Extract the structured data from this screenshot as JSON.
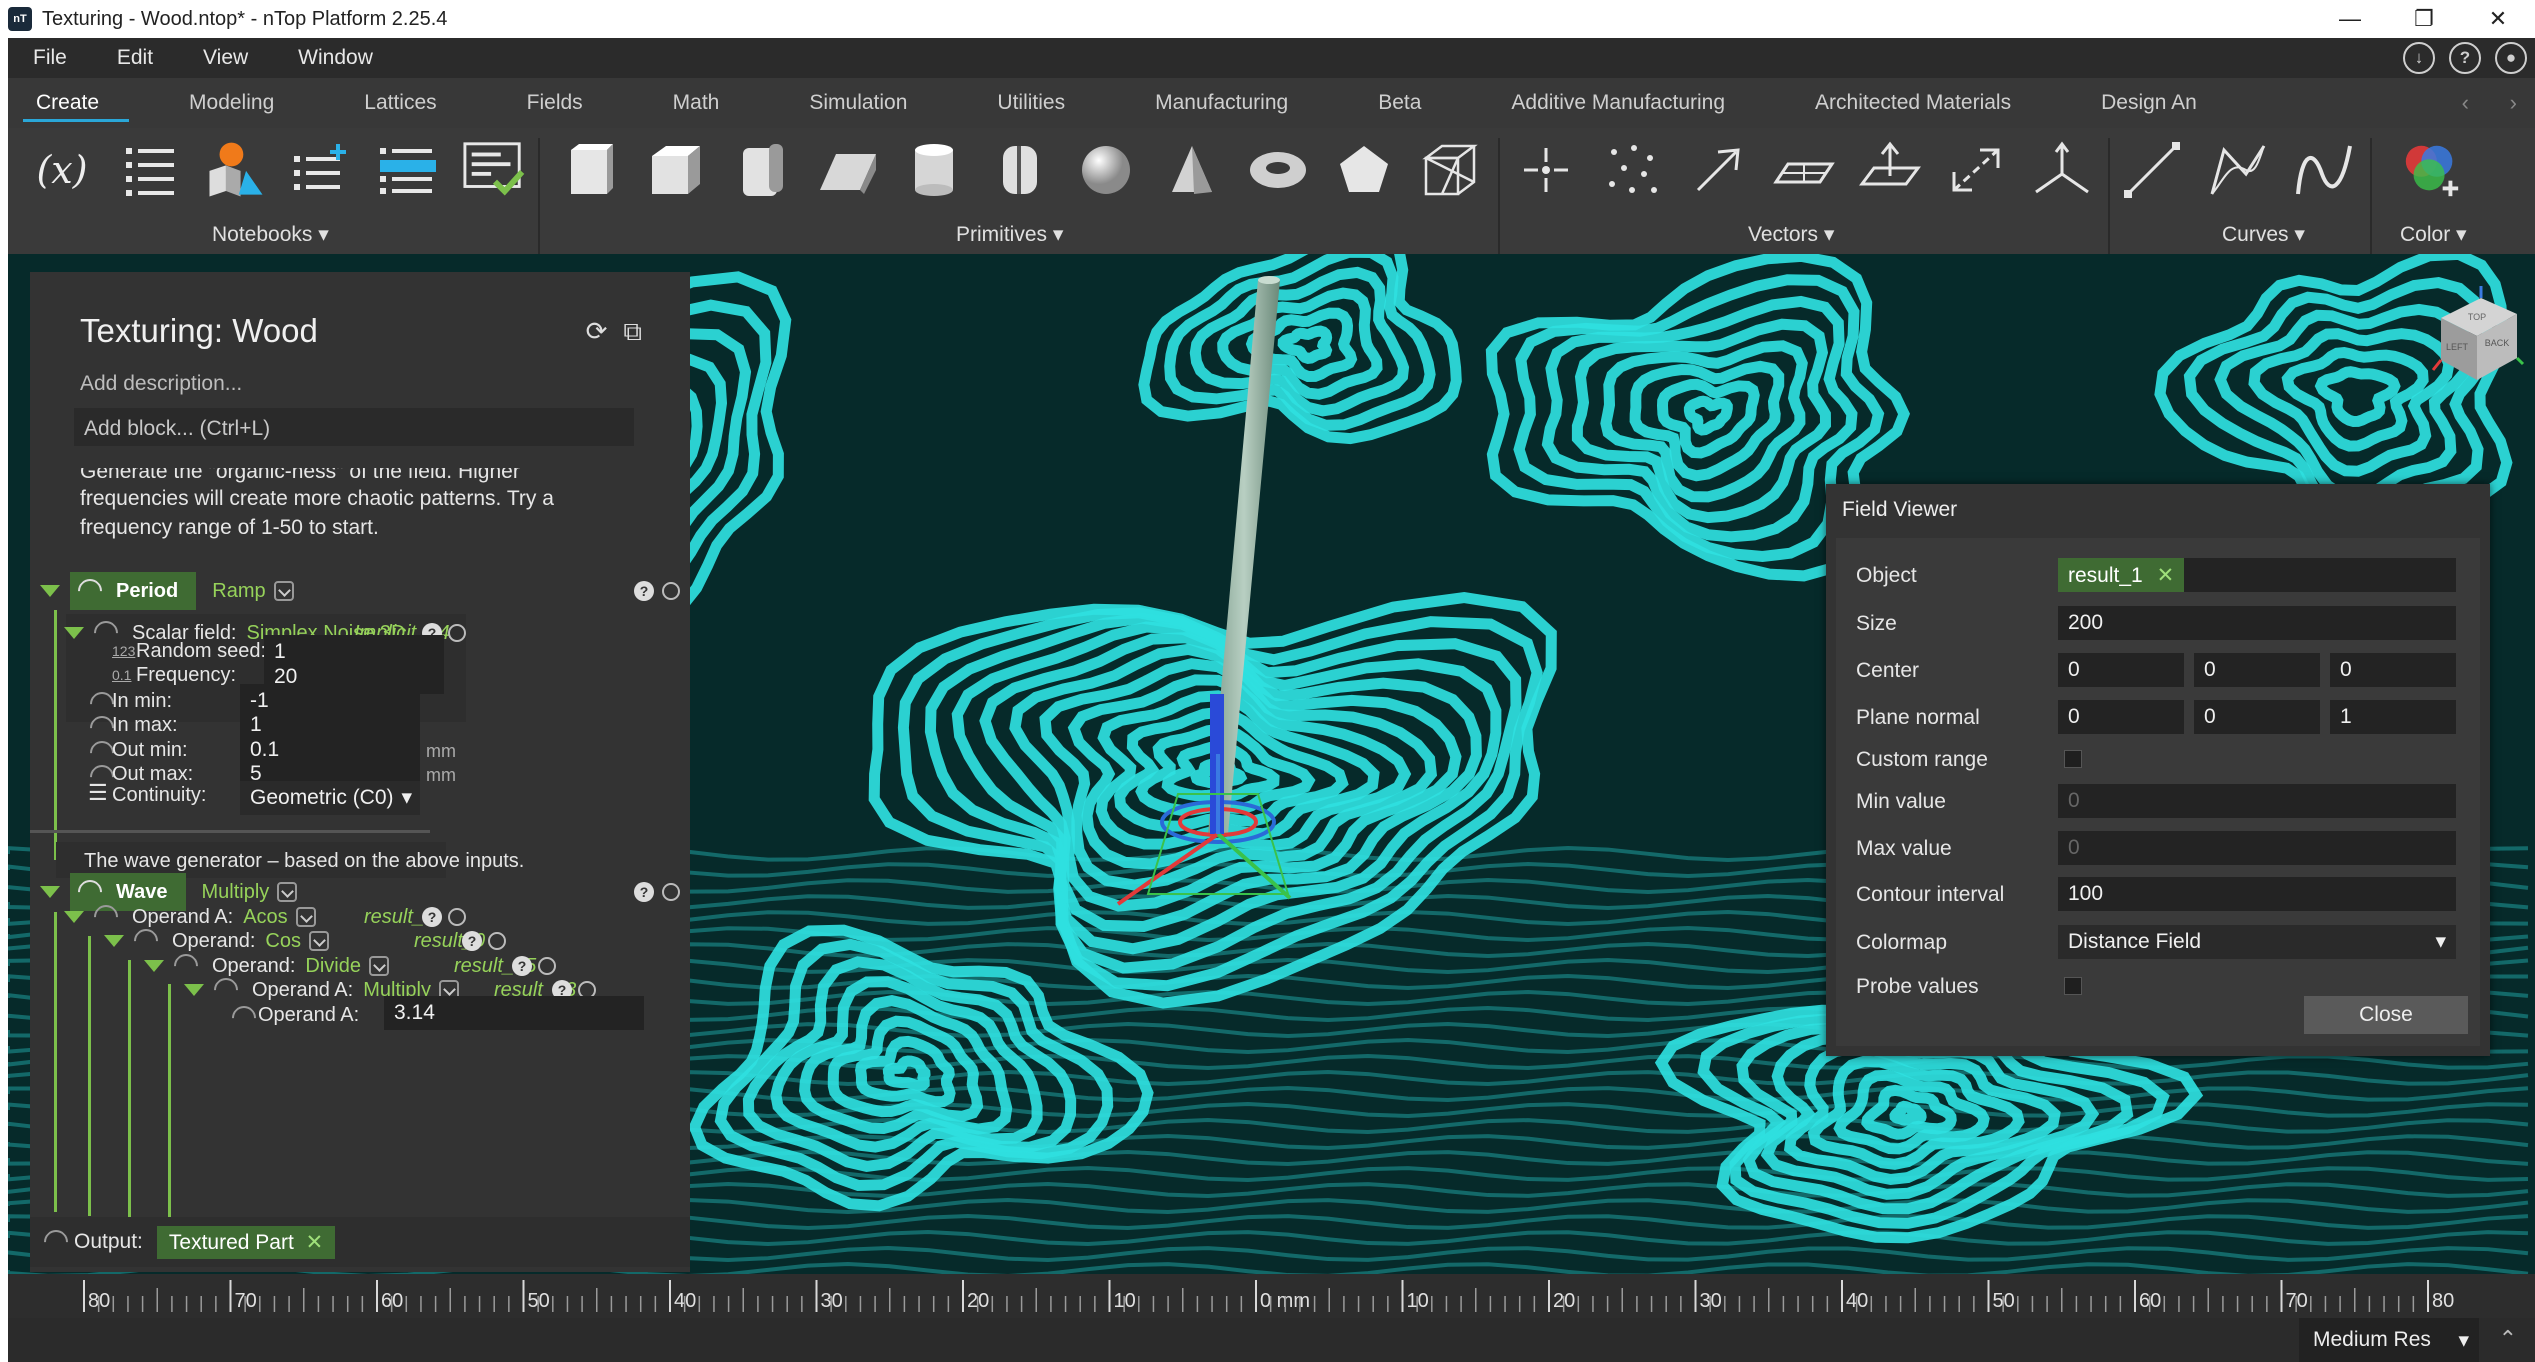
{
  "window": {
    "title": "Texturing - Wood.ntop* - nTop Platform 2.25.4",
    "controls": [
      "—",
      "❐",
      "✕"
    ]
  },
  "menu": [
    "File",
    "Edit",
    "View",
    "Window"
  ],
  "top_icons": [
    "download-icon",
    "help-icon",
    "user-icon"
  ],
  "tabs": [
    "Create",
    "Modeling",
    "Lattices",
    "Fields",
    "Math",
    "Simulation",
    "Utilities",
    "Manufacturing",
    "Beta",
    "Additive Manufacturing",
    "Architected Materials",
    "Design An"
  ],
  "active_tab": "Create",
  "ribbon_groups": {
    "notebooks": "Notebooks",
    "primitives": "Primitives",
    "vectors": "Vectors",
    "curves": "Curves",
    "color": "Color"
  },
  "ribbon_icons": {
    "variable_glyph": "(x)",
    "notebooks": [
      "variable-icon",
      "list-icon",
      "shapes-icon",
      "add-list-icon",
      "edit-list-icon",
      "notebook-check-icon"
    ],
    "primitives": [
      "box-icon",
      "cube-icon",
      "rounded-box-icon",
      "wedge-icon",
      "cylinder-icon",
      "capsule-icon",
      "sphere-icon",
      "cone-icon",
      "torus-icon",
      "pentagon-icon",
      "wireframe-cube-icon"
    ],
    "vectors": [
      "point-icon",
      "point-cloud-icon",
      "vector-icon",
      "plane-icon",
      "plane-normal-icon",
      "line-segment-icon",
      "coordinate-system-icon"
    ],
    "curves": [
      "line-icon",
      "polyline-icon",
      "spline-icon"
    ],
    "color": [
      "color-icon"
    ]
  },
  "notebook": {
    "title": "Texturing: Wood",
    "description_placeholder": "Add description...",
    "add_block_placeholder": "Add block... (Ctrl+L)",
    "note_lines": [
      "Generate the \"organic-ness\" of the field. Higher",
      "frequencies will create more chaotic patterns. Try a",
      "frequency range of 1-50 to start."
    ],
    "period": {
      "name": "Period",
      "type": "Ramp",
      "scalar_field_label": "Scalar field:",
      "scalar_field_value": "Simplex Noise 3D",
      "scalar_field_ref": "Implicit_14",
      "random_seed_label": "Random seed:",
      "random_seed_value": "1",
      "random_seed_badge": "123",
      "frequency_label": "Frequency:",
      "frequency_value": "20",
      "frequency_badge": "0.1",
      "in_min_label": "In min:",
      "in_min_value": "-1",
      "in_max_label": "In max:",
      "in_max_value": "1",
      "out_min_label": "Out min:",
      "out_min_value": "0.1",
      "out_min_unit": "mm",
      "out_max_label": "Out max:",
      "out_max_value": "5",
      "out_max_unit": "mm",
      "continuity_label": "Continuity:",
      "continuity_value": "Geometric (C0)"
    },
    "wave_note": "The wave generator – based on the above inputs.",
    "wave": {
      "name": "Wave",
      "type": "Multiply",
      "operand_a_label": "Operand A:",
      "operand_a_type": "Acos",
      "operand_a_ref": "result_1",
      "operand_label": "Operand:",
      "operand_type": "Cos",
      "operand_ref": "result_0",
      "operand2_label": "Operand:",
      "operand2_type": "Divide",
      "operand2_ref": "result_15",
      "operand3_label": "Operand A:",
      "operand3_type": "Multiply",
      "operand3_ref": "result_13",
      "operand4_label": "Operand A:",
      "operand4_value": "3.14"
    },
    "output_label": "Output:",
    "output_value": "Textured Part"
  },
  "field_viewer": {
    "title": "Field Viewer",
    "object_label": "Object",
    "object_value": "result_1",
    "size_label": "Size",
    "size_value": "200",
    "center_label": "Center",
    "center_values": [
      "0",
      "0",
      "0"
    ],
    "plane_normal_label": "Plane normal",
    "plane_normal_values": [
      "0",
      "0",
      "1"
    ],
    "custom_range_label": "Custom range",
    "min_value_label": "Min value",
    "min_value": "0",
    "max_value_label": "Max value",
    "max_value": "0",
    "contour_interval_label": "Contour interval",
    "contour_interval_value": "100",
    "colormap_label": "Colormap",
    "colormap_value": "Distance Field",
    "probe_values_label": "Probe values",
    "close_label": "Close"
  },
  "nav_cube": {
    "face_top": "TOP",
    "face_left": "LEFT",
    "face_back": "BACK"
  },
  "ruler": {
    "ticks": [
      "80",
      "70",
      "60",
      "50",
      "40",
      "30",
      "20",
      "10",
      "0 mm",
      "10",
      "20",
      "30",
      "40",
      "50",
      "60",
      "70",
      "80"
    ]
  },
  "status": {
    "resolution": "Medium Res"
  },
  "colors": {
    "accent_green": "#96d25a",
    "header_green": "#3f6b33",
    "field_cyan": "#2fe0e0",
    "tab_underline": "#2aa7d8"
  }
}
